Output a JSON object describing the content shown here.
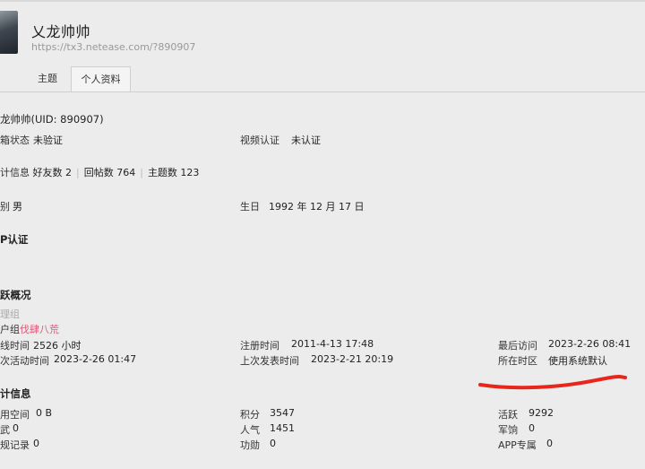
{
  "header": {
    "username": "乂龙帅帅",
    "profile_url": "https://tx3.netease.com/?890907"
  },
  "tabs": [
    {
      "label": "主题"
    },
    {
      "label": "个人资料"
    }
  ],
  "profile": {
    "name_uid": "龙帅帅(UID: 890907)",
    "email_status_label": "箱状态",
    "email_status_value": "未验证",
    "video_label": "视频认证",
    "video_value": "未认证",
    "stats_label": "计信息",
    "friends": "好友数 2",
    "replies": "回帖数 764",
    "topics": "主题数 123",
    "gender_label": "别",
    "gender_value": "男",
    "birthday_label": "生日",
    "birthday_value": "1992 年 12 月 17 日",
    "vip_heading": "P认证",
    "activity_heading": "跃概况",
    "mgmt_group": "理组",
    "user_group_label": "户组",
    "user_group_value": "伐肆八荒",
    "online_label": "线时间",
    "online_value": "2526 小时",
    "reg_label": "注册时间",
    "reg_value": "2011-4-13 17:48",
    "last_visit_label": "最后访问",
    "last_visit_value": "2023-2-26 08:41",
    "last_active_label": "次活动时间",
    "last_active_value": "2023-2-26 01:47",
    "last_post_label": "上次发表时间",
    "last_post_value": "2023-2-21 20:19",
    "timezone_label": "所在时区",
    "timezone_value": "使用系统默认",
    "stats_heading": "计信息",
    "space_label": "用空间",
    "space_value": "0 B",
    "points_label": "积分",
    "points_value": "3547",
    "active_label": "活跃",
    "active_value": "9292",
    "wu_label": "武",
    "wu_value": "0",
    "popularity_label": "人气",
    "popularity_value": "1451",
    "salary_label": "军饷",
    "salary_value": "0",
    "record_label": "规记录",
    "record_value": "0",
    "merit_label": "功勋",
    "merit_value": "0",
    "app_label": "APP专属",
    "app_value": "0"
  },
  "colors": {
    "accent_pink": "#e05a7b",
    "annotation_red": "#e8261b"
  }
}
